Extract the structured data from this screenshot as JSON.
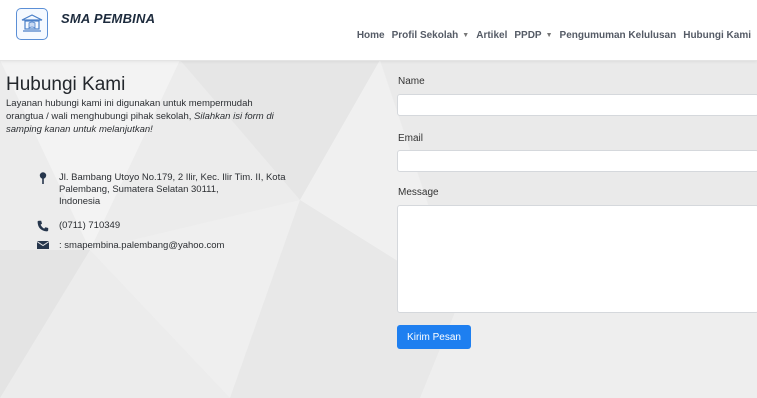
{
  "brand": {
    "name": "SMA PEMBINA",
    "logo_icon": "school-crest-icon"
  },
  "nav": [
    {
      "label": "Home",
      "dropdown": false
    },
    {
      "label": "Profil Sekolah",
      "dropdown": true
    },
    {
      "label": "Artikel",
      "dropdown": false
    },
    {
      "label": "PPDP",
      "dropdown": true
    },
    {
      "label": "Pengumuman Kelulusan",
      "dropdown": false
    },
    {
      "label": "Hubungi Kami",
      "dropdown": false
    }
  ],
  "contact": {
    "title": "Hubungi Kami",
    "intro_line1": "Layanan hubungi kami ini digunakan untuk mempermudah",
    "intro_line2": "orangtua / wali menghubungi pihak sekolah, ",
    "intro_italic": "Silahkan isi form di samping kanan untuk melanjutkan!",
    "address_line1": "Jl. Bambang Utoyo No.179, 2 Ilir, Kec. Ilir Tim. II, Kota",
    "address_line2": "Palembang, Sumatera Selatan 30111,",
    "address_line3": "Indonesia",
    "phone": "(0711) 710349",
    "email": ": smapembina.palembang@yahoo.com"
  },
  "form": {
    "name_label": "Name",
    "name_value": "",
    "email_label": "Email",
    "email_value": "",
    "message_label": "Message",
    "message_value": "",
    "submit_label": "Kirim Pesan"
  },
  "colors": {
    "accent": "#1e7ff0",
    "brand_text": "#1d2b3d",
    "nav_text": "#555b66"
  }
}
